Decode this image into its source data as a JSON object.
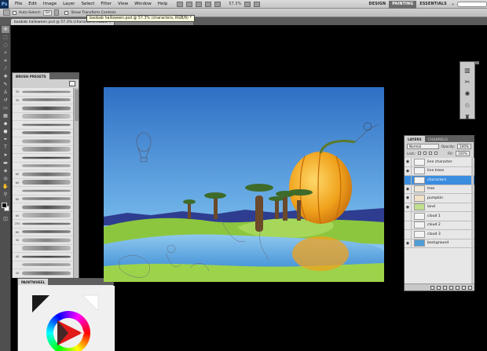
{
  "app": {
    "logo": "Ps"
  },
  "menu": [
    "File",
    "Edit",
    "Image",
    "Layer",
    "Select",
    "Filter",
    "View",
    "Window",
    "Help"
  ],
  "zoom": {
    "value": "57.3",
    "unit": "%"
  },
  "workspaces": {
    "items": [
      "DESIGN",
      "PAINTING",
      "ESSENTIALS"
    ],
    "active": "PAINTING",
    "more": "»"
  },
  "options": {
    "mode_label": "Auto-Select:",
    "mode_value": "Gr",
    "transform_label": "Show Transform Controls"
  },
  "document": {
    "tab_active": "baobab halloween.psd @ 57.3% (characters, RGB/8*)",
    "tab_other": "",
    "tooltip": "baobab halloween.psd @ 57.3% (characters, RGB/8) *"
  },
  "panels": {
    "brush_presets_title": "BRUSH PRESETS",
    "paint_wheel_title": "PAINTWHEEL",
    "layers_tab": "LAYERS",
    "channels_tab": "CHANNELS",
    "blend_mode": "Normal",
    "opacity_label": "Opacity:",
    "opacity_value": "100%",
    "lock_label": "Lock:",
    "fill_label": "Fill:",
    "fill_value": "100%"
  },
  "brush_sizes": [
    "30",
    "30",
    "",
    "",
    "",
    "",
    "",
    "",
    "",
    "",
    "60",
    "60",
    "",
    "60",
    "",
    "60",
    "250",
    "60",
    "30",
    "",
    "40",
    "",
    "40",
    ""
  ],
  "layers": [
    {
      "name": "line character",
      "visible": true,
      "active": false,
      "thumb": "#f4f4f4"
    },
    {
      "name": "line trees",
      "visible": true,
      "active": false,
      "thumb": "#f4f4f4"
    },
    {
      "name": "characters",
      "visible": false,
      "active": true,
      "thumb": "#f4f4f4"
    },
    {
      "name": "tree",
      "visible": true,
      "active": false,
      "thumb": "#efe9dc"
    },
    {
      "name": "pumpkin",
      "visible": true,
      "active": false,
      "thumb": "#f1e3c8"
    },
    {
      "name": "land",
      "visible": true,
      "active": false,
      "thumb": "#bfe08c"
    },
    {
      "name": "cloud 1",
      "visible": false,
      "active": false,
      "thumb": "#f4f4f4"
    },
    {
      "name": "cloud 2",
      "visible": false,
      "active": false,
      "thumb": "#f4f4f4"
    },
    {
      "name": "cloud 3",
      "visible": false,
      "active": false,
      "thumb": "#f4f4f4"
    },
    {
      "name": "background",
      "visible": true,
      "active": false,
      "thumb": "#4f9ed8"
    }
  ],
  "colors": {
    "sky_top": "#2f6fc4",
    "sky_bottom": "#86c4ee",
    "grass": "#8cc63f",
    "water": "#3f8fd6",
    "pumpkin": "#f0a21c",
    "active_layer": "#3b8de0"
  }
}
